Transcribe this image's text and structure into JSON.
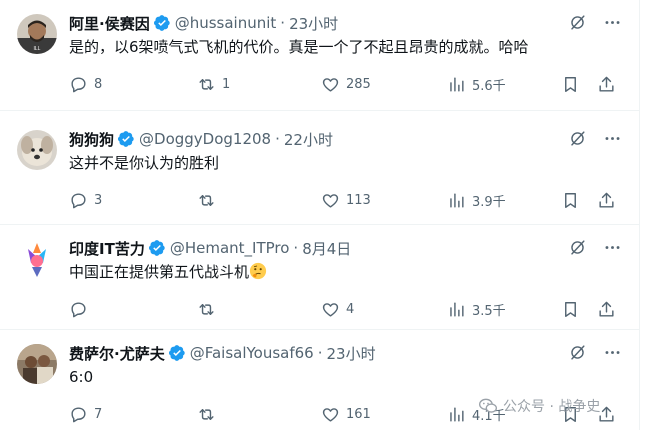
{
  "tweets": [
    {
      "display_name": "阿里·侯赛因",
      "handle": "@hussainunit",
      "time": "23小时",
      "text": "是的，以6架喷气式飞机的代价。真是一个了不起且昂贵的成就。哈哈",
      "replies": "8",
      "retweets": "1",
      "likes": "285",
      "views": "5.6千",
      "avatar_color": "#6b6255"
    },
    {
      "display_name": "狗狗狗",
      "handle": "@DoggyDog1208",
      "time": "22小时",
      "text": "这并不是你认为的胜利",
      "replies": "3",
      "retweets": "",
      "likes": "113",
      "views": "3.9千",
      "avatar_color": "#d9cfc2"
    },
    {
      "display_name": "印度IT苦力",
      "handle": "@Hemant_ITPro",
      "time": "8月4日",
      "text": "中国正在提供第五代战斗机",
      "emoji": "thinking-face",
      "replies": "",
      "retweets": "",
      "likes": "4",
      "views": "3.5千",
      "avatar_color": "#ffffff"
    },
    {
      "display_name": "费萨尔·尤萨夫",
      "handle": "@FaisalYousaf66",
      "time": "23小时",
      "text": "6:0",
      "replies": "7",
      "retweets": "",
      "likes": "161",
      "views": "4.1千",
      "avatar_color": "#7a6a58"
    }
  ],
  "separator_dot": "·",
  "watermark": {
    "text": "公众号 · 战争史",
    "icon": "wechat-icon"
  },
  "colors": {
    "verified": "#1d9bf0",
    "secondary_text": "#536471",
    "divider": "#eff3f4"
  }
}
